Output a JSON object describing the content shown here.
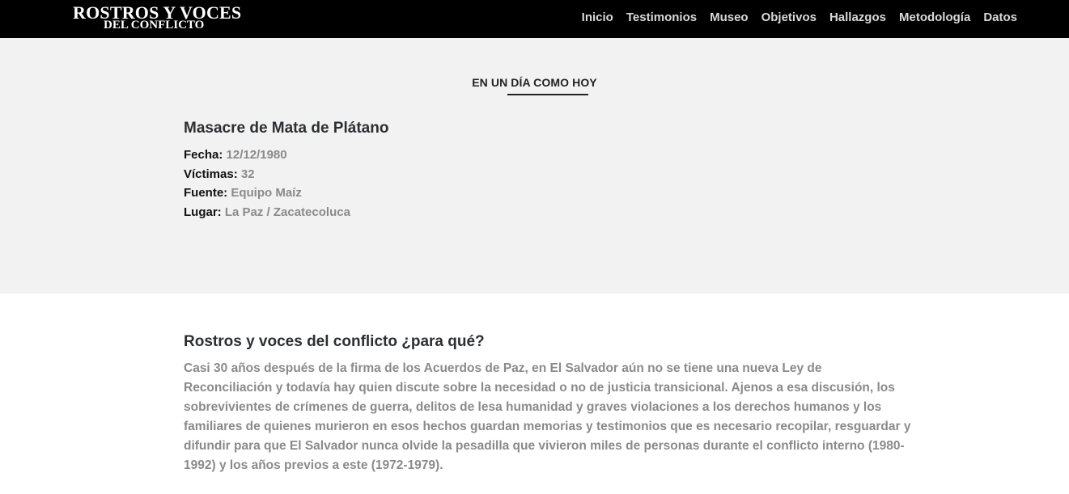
{
  "header": {
    "logo_line1": "ROSTROS Y VOCES",
    "logo_line2": "DEL CONFLICTO",
    "nav": [
      "Inicio",
      "Testimonios",
      "Museo",
      "Objetivos",
      "Hallazgos",
      "Metodología",
      "Datos"
    ]
  },
  "today": {
    "heading": "EN UN DÍA COMO HOY",
    "title": "Masacre de Mata de Plátano",
    "fields": [
      {
        "label": "Fecha:",
        "value": "12/12/1980"
      },
      {
        "label": "Víctimas:",
        "value": "32"
      },
      {
        "label": "Fuente:",
        "value": "Equipo Maíz"
      },
      {
        "label": "Lugar:",
        "value": "La Paz / Zacatecoluca"
      }
    ]
  },
  "about": {
    "title": "Rostros y voces del conflicto ¿para qué?",
    "body": "Casi 30 años después de la firma de los Acuerdos de Paz, en El Salvador aún no se tiene una nueva Ley de Reconciliación y todavía hay quien discute sobre la necesidad o no de justicia transicional. Ajenos a esa discusión, los sobrevivientes de crímenes de guerra, delitos de lesa humanidad y graves violaciones a los derechos humanos y los familiares de quienes murieron en esos hechos guardan memorias y testimonios que es necesario recopilar, resguardar y difundir para que El Salvador nunca olvide la pesadilla que vivieron miles de personas durante el conflicto interno (1980-1992) y los años previos a este (1972-1979)."
  },
  "colors": {
    "topbar": "#000000",
    "section_bg": "#f2f2f2",
    "value_text": "#8a8a8a"
  }
}
